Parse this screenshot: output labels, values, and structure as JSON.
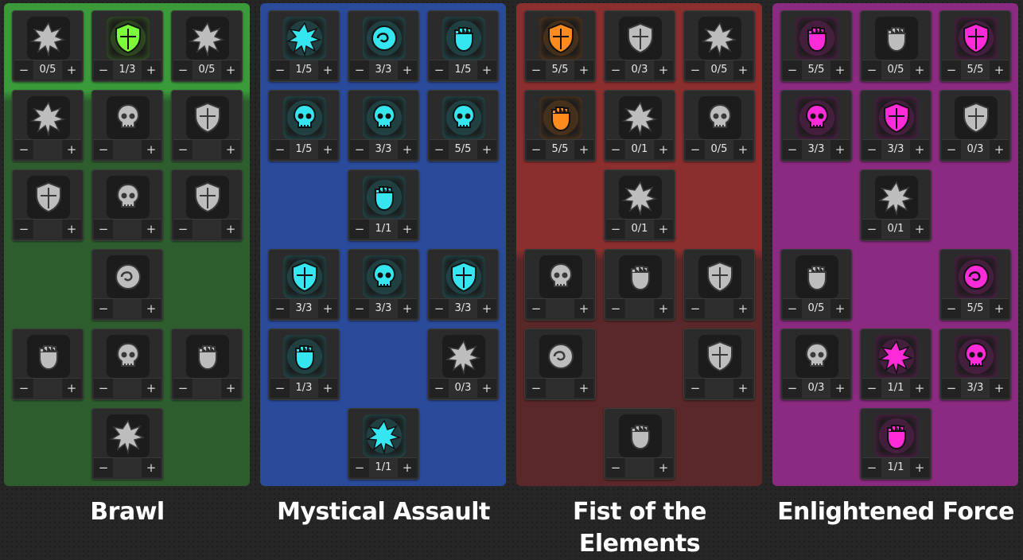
{
  "controls": {
    "minus": "−",
    "plus": "+"
  },
  "trees": [
    {
      "title": "Brawl",
      "bg": "#2e5e2e",
      "bg_top": "#3a9a3a",
      "nodes": [
        {
          "icon": "fist-stamp-icon",
          "value": "0/5",
          "lit": false
        },
        {
          "icon": "glowing-fist-icon",
          "value": "1/3",
          "lit": true
        },
        {
          "icon": "fist-plus-icon",
          "value": "0/5",
          "lit": false
        },
        {
          "icon": "octopus-icon",
          "value": "",
          "lit": false
        },
        {
          "icon": "skull-plus-icon",
          "value": "",
          "lit": false
        },
        {
          "icon": "knot-icon",
          "value": "",
          "lit": false
        },
        {
          "icon": "bandaged-shield-icon",
          "value": "",
          "lit": false
        },
        {
          "icon": "scythe-impact-icon",
          "value": "",
          "lit": false
        },
        {
          "icon": "rabbit-icon",
          "value": "",
          "lit": false
        },
        {
          "icon": "spiked-fist-icon",
          "value": "",
          "lit": false
        },
        {
          "icon": "shattered-rock-icon",
          "value": "",
          "lit": false
        },
        {
          "icon": "crossed-fist-icon",
          "value": "",
          "lit": false
        },
        {
          "icon": "winged-figure-icon",
          "value": "",
          "lit": false
        },
        {
          "icon": "bomb-icon",
          "value": "",
          "lit": false
        }
      ]
    },
    {
      "title": "Mystical Assault",
      "bg": "#2a4a9a",
      "bg_top": "#2a4a9a",
      "nodes": [
        {
          "icon": "twin-skulls-icon",
          "value": "1/5",
          "lit": true
        },
        {
          "icon": "winged-blade-icon",
          "value": "3/3",
          "lit": true
        },
        {
          "icon": "skull-banner-icon",
          "value": "1/5",
          "lit": true
        },
        {
          "icon": "arrow-bracer-icon",
          "value": "1/5",
          "lit": true
        },
        {
          "icon": "crosshair-icon",
          "value": "3/3",
          "lit": true
        },
        {
          "icon": "spirit-fists-icon",
          "value": "5/5",
          "lit": true
        },
        {
          "icon": "rising-spirit-icon",
          "value": "1/1",
          "lit": true
        },
        {
          "icon": "energy-orb-icon",
          "value": "3/3",
          "lit": true
        },
        {
          "icon": "impact-skull-icon",
          "value": "3/3",
          "lit": true
        },
        {
          "icon": "crossed-swords-icon",
          "value": "3/3",
          "lit": true
        },
        {
          "icon": "vortex-icon",
          "value": "1/3",
          "lit": true
        },
        {
          "icon": "crowned-skull-icon",
          "value": "0/3",
          "lit": false
        },
        {
          "icon": "spiral-shield-icon",
          "value": "1/1",
          "lit": true
        }
      ]
    },
    {
      "title": "Fist of the Elements",
      "bg": "#5a2828",
      "bg_top": "#8a2e2e",
      "nodes": [
        {
          "icon": "hourglass-flame-icon",
          "value": "5/5",
          "lit": true
        },
        {
          "icon": "targeted-fist-icon",
          "value": "0/3",
          "lit": false
        },
        {
          "icon": "stone-claw-icon",
          "value": "0/5",
          "lit": false
        },
        {
          "icon": "burning-skull-icon",
          "value": "5/5",
          "lit": true
        },
        {
          "icon": "cracked-fist-icon",
          "value": "0/1",
          "lit": false
        },
        {
          "icon": "skull-pile-icon",
          "value": "0/5",
          "lit": false
        },
        {
          "icon": "gripped-skull-icon",
          "value": "0/1",
          "lit": false
        },
        {
          "icon": "lightning-strike-icon",
          "value": "",
          "lit": false
        },
        {
          "icon": "burning-bar-icon",
          "value": "",
          "lit": false
        },
        {
          "icon": "mushroom-skull-icon",
          "value": "",
          "lit": false
        },
        {
          "icon": "bound-heart-icon",
          "value": "",
          "lit": false
        },
        {
          "icon": "serpent-icon",
          "value": "",
          "lit": false
        },
        {
          "icon": "pistol-icon",
          "value": "",
          "lit": false
        }
      ]
    },
    {
      "title": "Enlightened Force",
      "bg": "#8a2a80",
      "bg_top": "#8a2a80",
      "nodes": [
        {
          "icon": "crest-shield-icon",
          "value": "5/5",
          "lit": true
        },
        {
          "icon": "clenched-fist-icon",
          "value": "0/5",
          "lit": false
        },
        {
          "icon": "winged-helm-icon",
          "value": "5/5",
          "lit": true
        },
        {
          "icon": "potion-icon",
          "value": "3/3",
          "lit": true
        },
        {
          "icon": "fanged-maw-icon",
          "value": "3/3",
          "lit": true
        },
        {
          "icon": "fist-cross-icon",
          "value": "0/3",
          "lit": false
        },
        {
          "icon": "dark-fist-icon",
          "value": "0/1",
          "lit": false
        },
        {
          "icon": "rising-fist-icon",
          "value": "0/5",
          "lit": false
        },
        {
          "icon": "fury-face-icon",
          "value": "5/5",
          "lit": true
        },
        {
          "icon": "sunken-blade-icon",
          "value": "0/3",
          "lit": false
        },
        {
          "icon": "crystal-shard-icon",
          "value": "1/1",
          "lit": true
        },
        {
          "icon": "radiant-burst-icon",
          "value": "3/3",
          "lit": true
        },
        {
          "icon": "glyph-rune-icon",
          "value": "1/1",
          "lit": true
        }
      ]
    }
  ],
  "colors": {
    "brawl_glow": "#7cff3a",
    "mystic_glow": "#35e6f0",
    "elements_glow": "#ff8a1e",
    "force_glow": "#ff2ad8",
    "inactive_icon": "#bdbdbd"
  }
}
